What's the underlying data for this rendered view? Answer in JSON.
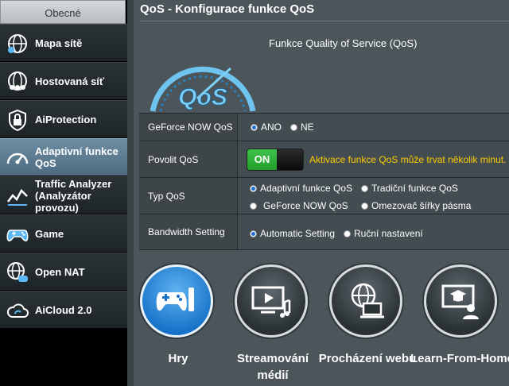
{
  "sidebar": {
    "header": "Obecné",
    "items": [
      {
        "label": "Mapa sítě",
        "icon": "globe-network-icon"
      },
      {
        "label": "Hostovaná síť",
        "icon": "guest-network-icon"
      },
      {
        "label": "AiProtection",
        "icon": "lock-shield-icon"
      },
      {
        "label": "Adaptivní funkce QoS",
        "icon": "speedometer-icon",
        "active": true
      },
      {
        "label": "Traffic Analyzer (Analyzátor provozu)",
        "icon": "traffic-chart-icon"
      },
      {
        "label": "Game",
        "icon": "gamepad-icon"
      },
      {
        "label": "Open NAT",
        "icon": "globe-gamepad-icon"
      },
      {
        "label": "AiCloud 2.0",
        "icon": "cloud-icon"
      }
    ]
  },
  "main": {
    "title": "QoS - Konfigurace funkce QoS",
    "subtitle": "Funkce Quality of Service (QoS)",
    "logo_text": "QoS"
  },
  "settings": {
    "geforce": {
      "label": "GeForce NOW QoS",
      "options": [
        {
          "label": "ANO",
          "selected": true
        },
        {
          "label": "NE",
          "selected": false
        }
      ]
    },
    "enable": {
      "label": "Povolit QoS",
      "toggle": "ON",
      "toggle_on": true,
      "note": "Aktivace funkce QoS může trvat několik minut."
    },
    "type": {
      "label": "Typ QoS",
      "options": [
        {
          "label": "Adaptivní funkce QoS",
          "selected": true
        },
        {
          "label": "Tradiční funkce QoS",
          "selected": false
        },
        {
          "label": "GeForce NOW QoS",
          "selected": false
        },
        {
          "label": "Omezovač šířky pásma",
          "selected": false
        }
      ]
    },
    "bandwidth": {
      "label": "Bandwidth Setting",
      "options": [
        {
          "label": "Automatic Setting",
          "selected": true
        },
        {
          "label": "Ruční nastavení",
          "selected": false
        }
      ]
    }
  },
  "modes": [
    {
      "label": "Hry",
      "icon": "gamepad-icon",
      "active": true
    },
    {
      "label": "Streamování médií",
      "icon": "media-streaming-icon",
      "active": false
    },
    {
      "label": "Procházení webu",
      "icon": "web-browsing-icon",
      "active": false
    },
    {
      "label": "Learn-From-Home",
      "icon": "learn-from-home-icon",
      "active": false
    }
  ],
  "colors": {
    "accent": "#1d6fd6",
    "warning": "#ffcc00",
    "toggle_on": "#2fb03a"
  }
}
